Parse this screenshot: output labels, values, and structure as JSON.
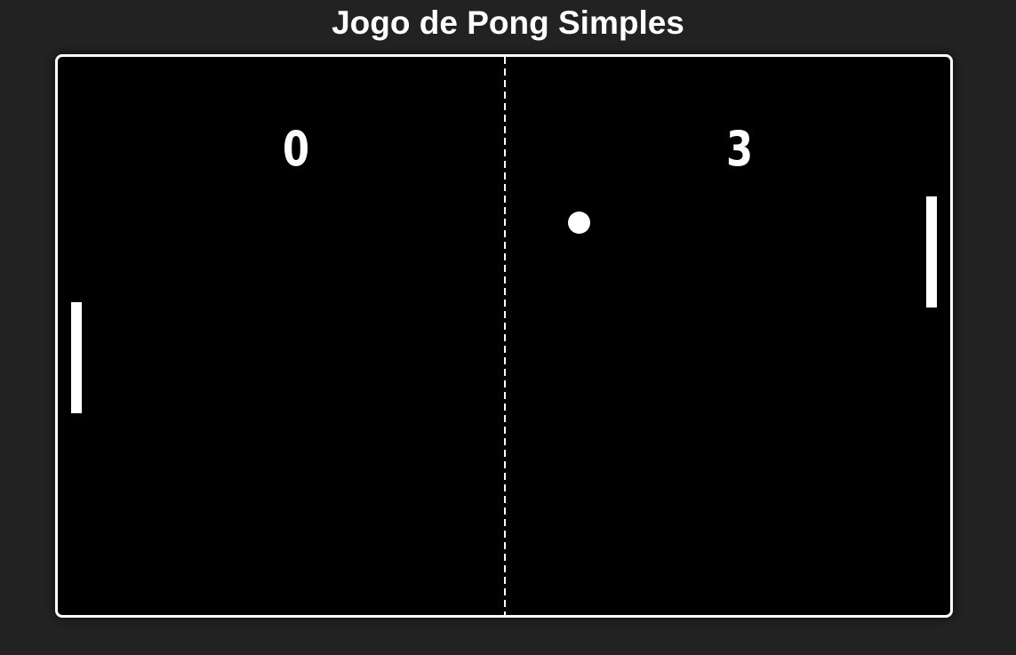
{
  "page": {
    "title": "Jogo de Pong Simples"
  },
  "game": {
    "score_left": "0",
    "score_right": "3",
    "colors": {
      "background": "#222222",
      "field": "#000000",
      "foreground": "#ffffff"
    }
  }
}
